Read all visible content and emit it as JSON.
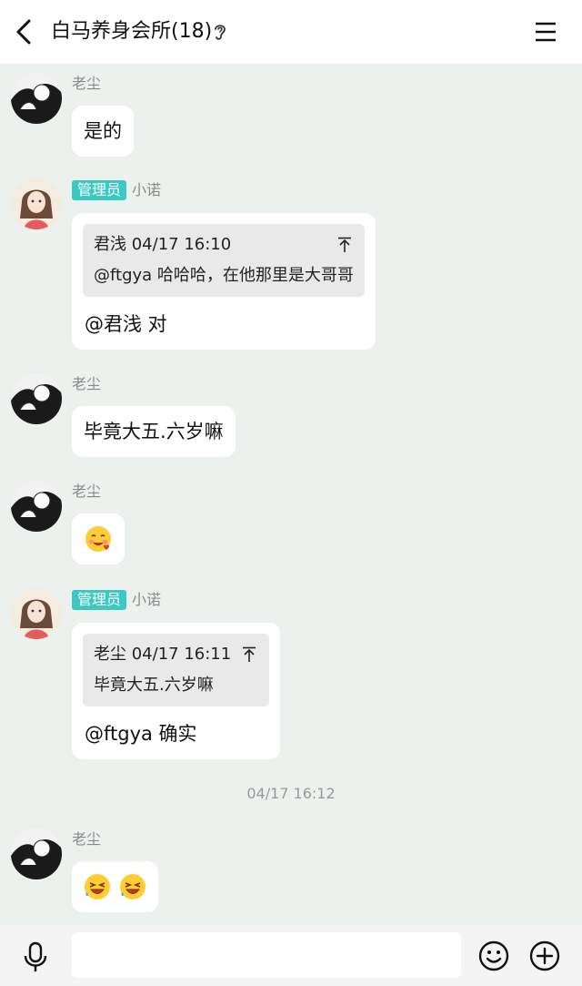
{
  "header": {
    "title": "白马养身会所(18)",
    "back_icon": "chevron-left-icon",
    "ear_icon": "ear-icon",
    "menu_icon": "hamburger-menu-icon"
  },
  "messages": [
    {
      "sender": "老尘",
      "text": "是的"
    },
    {
      "sender": "小诺",
      "badge": "管理员",
      "quote": {
        "meta": "君浅 04/17 16:10",
        "text": "@ftgya 哈哈哈，在他那里是大哥哥"
      },
      "text": "@君浅 对"
    },
    {
      "sender": "老尘",
      "text": "毕竟大五.六岁嘛"
    },
    {
      "sender": "老尘",
      "emoji": "blushing-hearts-emoji"
    },
    {
      "sender": "小诺",
      "badge": "管理员",
      "quote": {
        "meta": "老尘 04/17 16:11",
        "text": "毕竟大五.六岁嘛"
      },
      "text": "@ftgya 确实"
    },
    {
      "sender": "老尘",
      "emoji": "laughing-tears-emoji"
    }
  ],
  "timestamp": "04/17 16:12",
  "inputbar": {
    "mic_icon": "microphone-icon",
    "emoji_icon": "smiley-icon",
    "plus_icon": "plus-circle-icon",
    "placeholder": ""
  },
  "colors": {
    "badge": "#3cc9c4",
    "background": "#edf1ee"
  }
}
